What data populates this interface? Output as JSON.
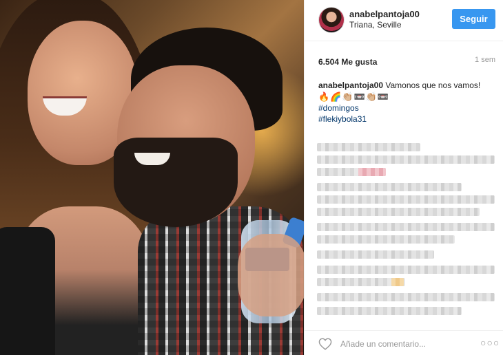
{
  "post": {
    "username": "anabelpantoja00",
    "location": "Triana, Seville",
    "follow_label": "Seguir",
    "likes": "6.504 Me gusta",
    "time_ago": "1 sem",
    "caption_user": "anabelpantoja00",
    "caption_text": "Vamonos que nos vamos!",
    "caption_emojis": "🔥🌈👏🏼📼👏🏼📼",
    "hashtags": [
      "#domingos",
      "#flekiybola31"
    ]
  },
  "footer": {
    "comment_placeholder": "Añade un comentario...",
    "more_label": "○○○"
  },
  "icons": {
    "heart": "heart-outline-icon",
    "more": "more-options-icon"
  },
  "colors": {
    "follow_button": "#3897f0",
    "hashtag": "#003569",
    "muted_text": "#999999"
  }
}
